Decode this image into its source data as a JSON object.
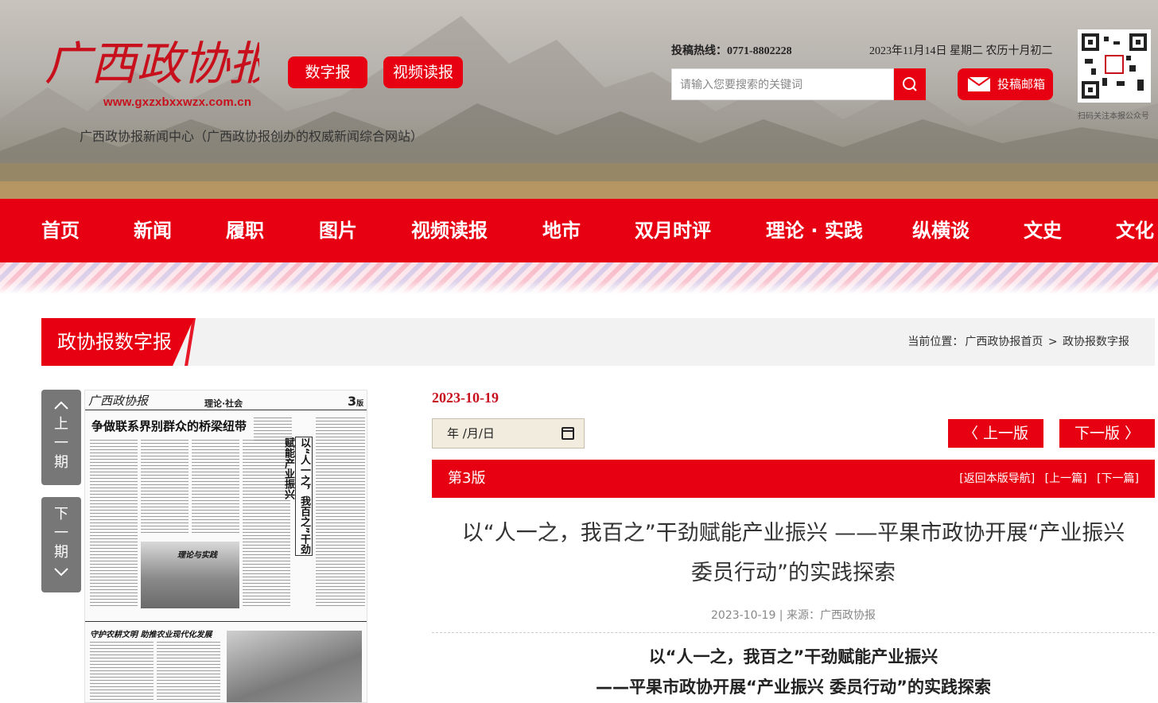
{
  "header": {
    "logo_text": "广西政协报",
    "url": "www.gxzxbxxwzx.com.cn",
    "subtitle": "广西政协报新闻中心（广西政协报创办的权威新闻综合网站）",
    "buttons": [
      "数字报",
      "视频读报"
    ],
    "hotline_label": "投稿热线：0771-8802228",
    "date": "2023年11月14日 星期二 农历十月初二",
    "search_placeholder": "请输入您要搜索的关键词",
    "mail_label": "投稿邮箱",
    "qr_caption": "扫码关注本报公众号",
    "accent_color": "#e60012"
  },
  "nav": [
    "首页",
    "新闻",
    "履职",
    "图片",
    "视频读报",
    "地市",
    "双月时评",
    "理论 · 实践",
    "纵横谈",
    "文史",
    "文化"
  ],
  "section": {
    "title": "政协报数字报",
    "breadcrumb_label": "当前位置：",
    "breadcrumb": [
      "广西政协报首页",
      "政协报数字报"
    ],
    "separator": ">"
  },
  "pager": {
    "prev": [
      "上",
      "一",
      "期"
    ],
    "next": [
      "下",
      "一",
      "期"
    ]
  },
  "paper_thumb": {
    "masthead": "广西政协报",
    "section_name": "理论·社会",
    "page_no": "3",
    "page_suffix": "版",
    "headline": "争做联系界别群众的桥梁纽带",
    "vertical_headline": "以“人一之，我百之”干劲赋能产业振兴",
    "photo_caption": "理论与实践",
    "bottom_headline": "守护农耕文明 助推农业现代化发展"
  },
  "edition": {
    "date": "2023-10-19",
    "date_input_display": "年 /月/日",
    "prev_label": "上一版",
    "next_label": "下一版",
    "banner": "第3版",
    "links": [
      "[返回本版导航]",
      "[上一篇]",
      "[下一篇]"
    ]
  },
  "article": {
    "title_line1": "以“人一之，我百之”干劲赋能产业振兴 ——平果市政协开展“产业振兴",
    "title_line2": "委员行动”的实践探索",
    "meta": "2023-10-19 | 来源：广西政协报",
    "body_head1": "以“人一之，我百之”干劲赋能产业振兴",
    "body_head2": "——平果市政协开展“产业振兴 委员行动”的实践探索"
  }
}
